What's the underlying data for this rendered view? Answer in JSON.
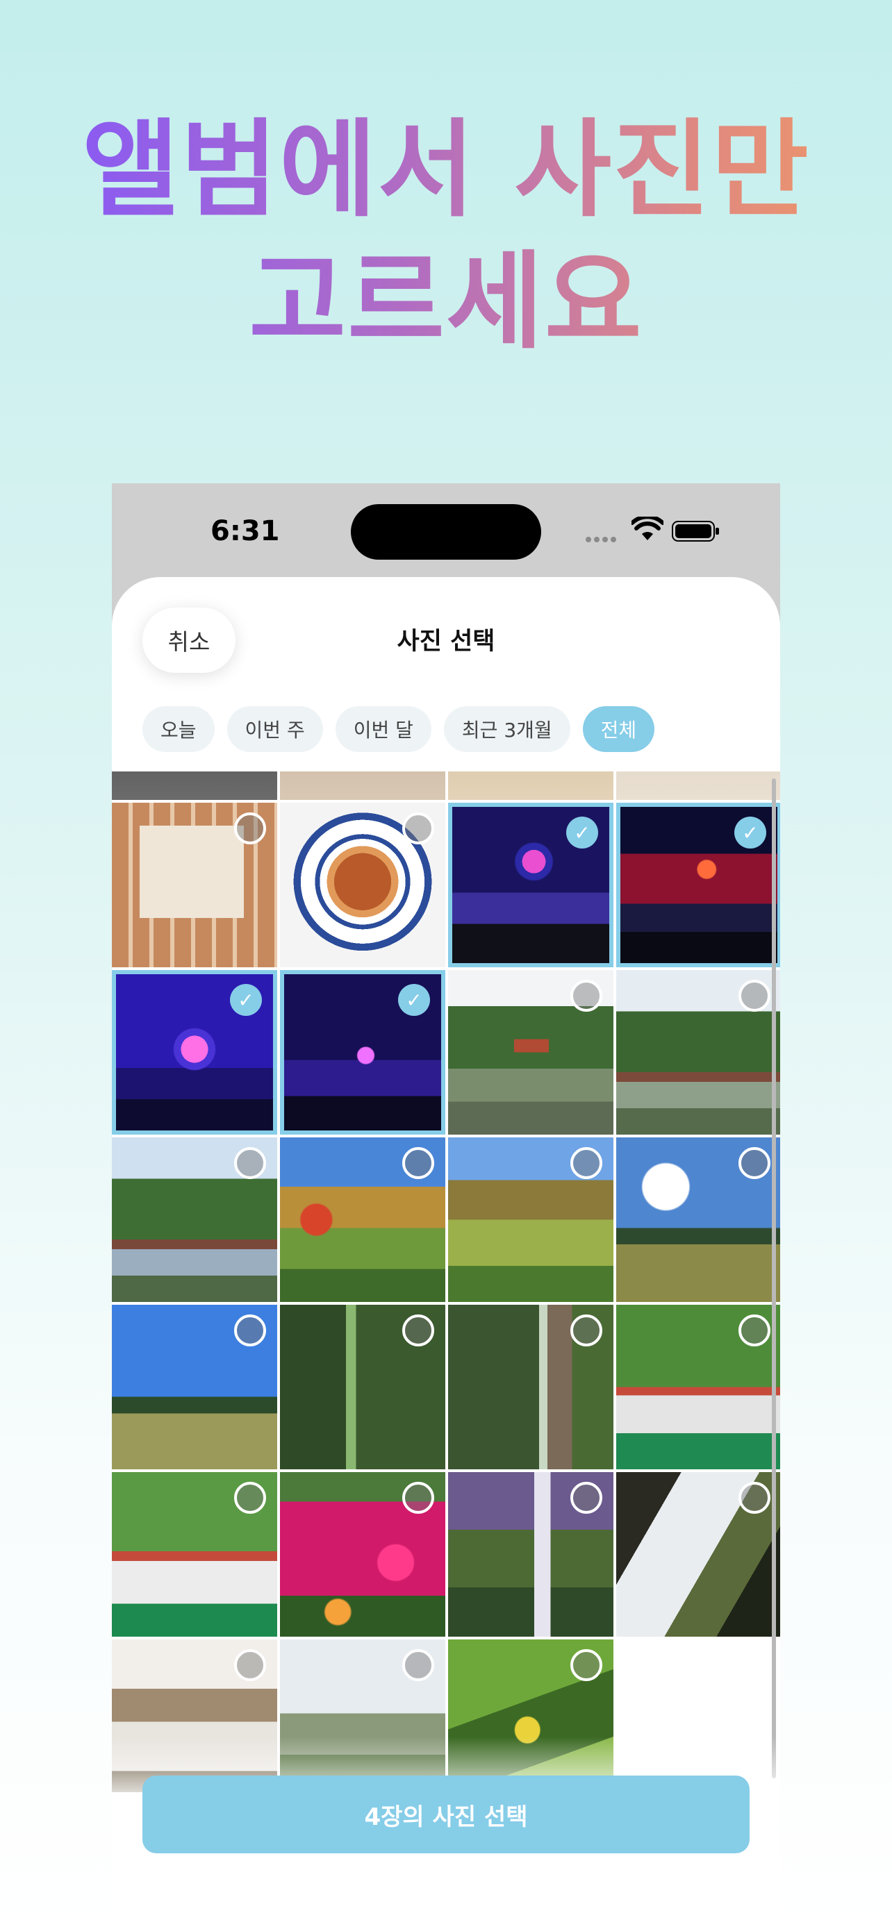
{
  "headline": {
    "line1": "앨범에서 사진만",
    "line2": "고르세요"
  },
  "status_bar": {
    "time": "6:31"
  },
  "sheet": {
    "cancel_label": "취소",
    "title": "사진 선택"
  },
  "filters": [
    {
      "label": "오늘",
      "active": false
    },
    {
      "label": "이번 주",
      "active": false
    },
    {
      "label": "이번 달",
      "active": false
    },
    {
      "label": "최근 3개월",
      "active": false
    },
    {
      "label": "전체",
      "active": true
    }
  ],
  "photos": [
    {
      "subject": "duck-display",
      "selected": false
    },
    {
      "subject": "braised-dish",
      "selected": false
    },
    {
      "subject": "concert-stage",
      "selected": true
    },
    {
      "subject": "concert-stage",
      "selected": true
    },
    {
      "subject": "concert-stage",
      "selected": true
    },
    {
      "subject": "concert-stage",
      "selected": true
    },
    {
      "subject": "temple-pond",
      "selected": false
    },
    {
      "subject": "temple-pond",
      "selected": false
    },
    {
      "subject": "temple-pond",
      "selected": false
    },
    {
      "subject": "autumn-field",
      "selected": false
    },
    {
      "subject": "autumn-field",
      "selected": false
    },
    {
      "subject": "open-sky-field",
      "selected": false
    },
    {
      "subject": "open-sky-field",
      "selected": false
    },
    {
      "subject": "gorge",
      "selected": false
    },
    {
      "subject": "gorge",
      "selected": false
    },
    {
      "subject": "dance-performance",
      "selected": false
    },
    {
      "subject": "dance-performance",
      "selected": false
    },
    {
      "subject": "flowers",
      "selected": false
    },
    {
      "subject": "waterfall",
      "selected": false
    },
    {
      "subject": "waterfall",
      "selected": false
    },
    {
      "subject": "waterfall",
      "selected": false
    },
    {
      "subject": "grass",
      "selected": false
    },
    {
      "subject": "lemon-tree",
      "selected": false
    }
  ],
  "confirm_label": "4장의 사진 선택",
  "colors": {
    "accent": "#86cde8"
  }
}
